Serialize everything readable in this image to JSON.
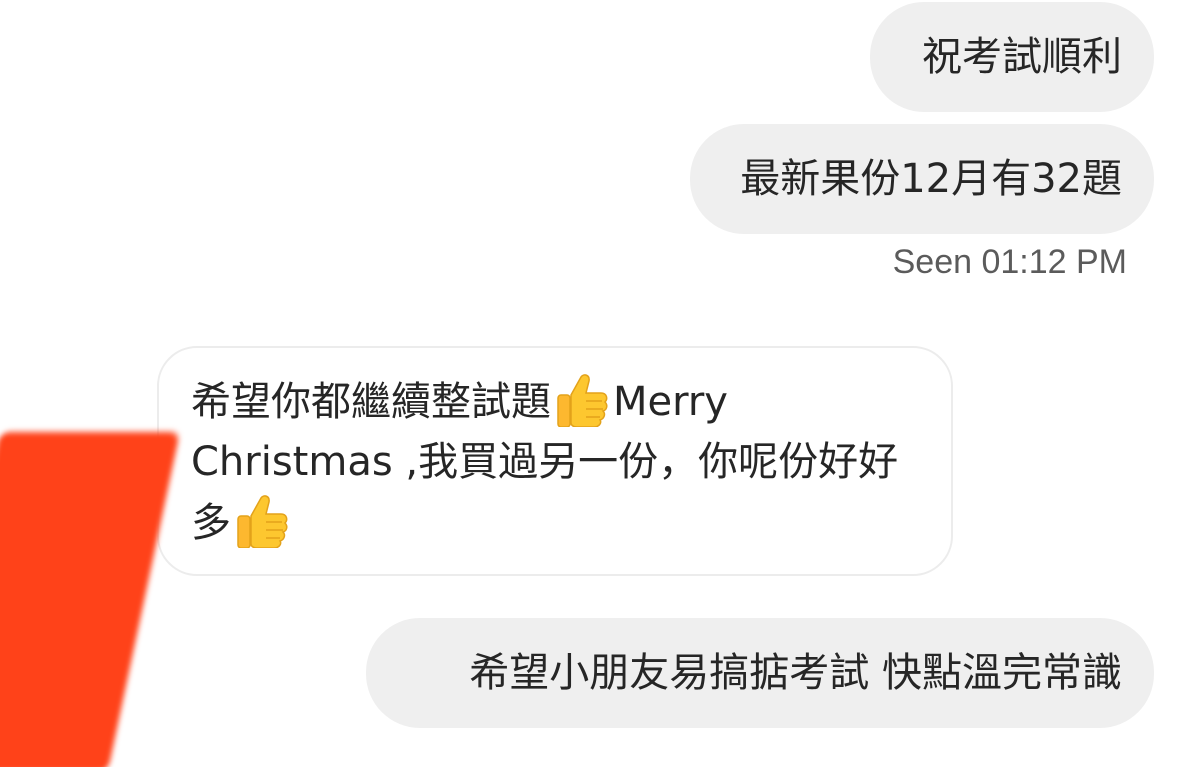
{
  "messages": [
    {
      "id": "m1",
      "direction": "outgoing",
      "text": "祝考試順利"
    },
    {
      "id": "m2",
      "direction": "outgoing",
      "text": "最新果份12月有32題"
    },
    {
      "id": "m3",
      "direction": "incoming",
      "text_part1": "希望你都繼續整試題",
      "emoji1": "thumbs-up-icon",
      "text_part2": "Merry Christmas ,我買過另一份，你呢份好好多",
      "emoji2": "thumbs-up-icon"
    },
    {
      "id": "m4",
      "direction": "outgoing",
      "text": "希望小朋友易搞掂考試 快點溫完常識"
    }
  ],
  "seen_status": "Seen 01:12 PM",
  "colors": {
    "outgoing_bubble": "#efefef",
    "incoming_border": "#ececec",
    "text": "#262626",
    "seen_text": "#5b5b5b",
    "redaction": "#ff4219"
  }
}
